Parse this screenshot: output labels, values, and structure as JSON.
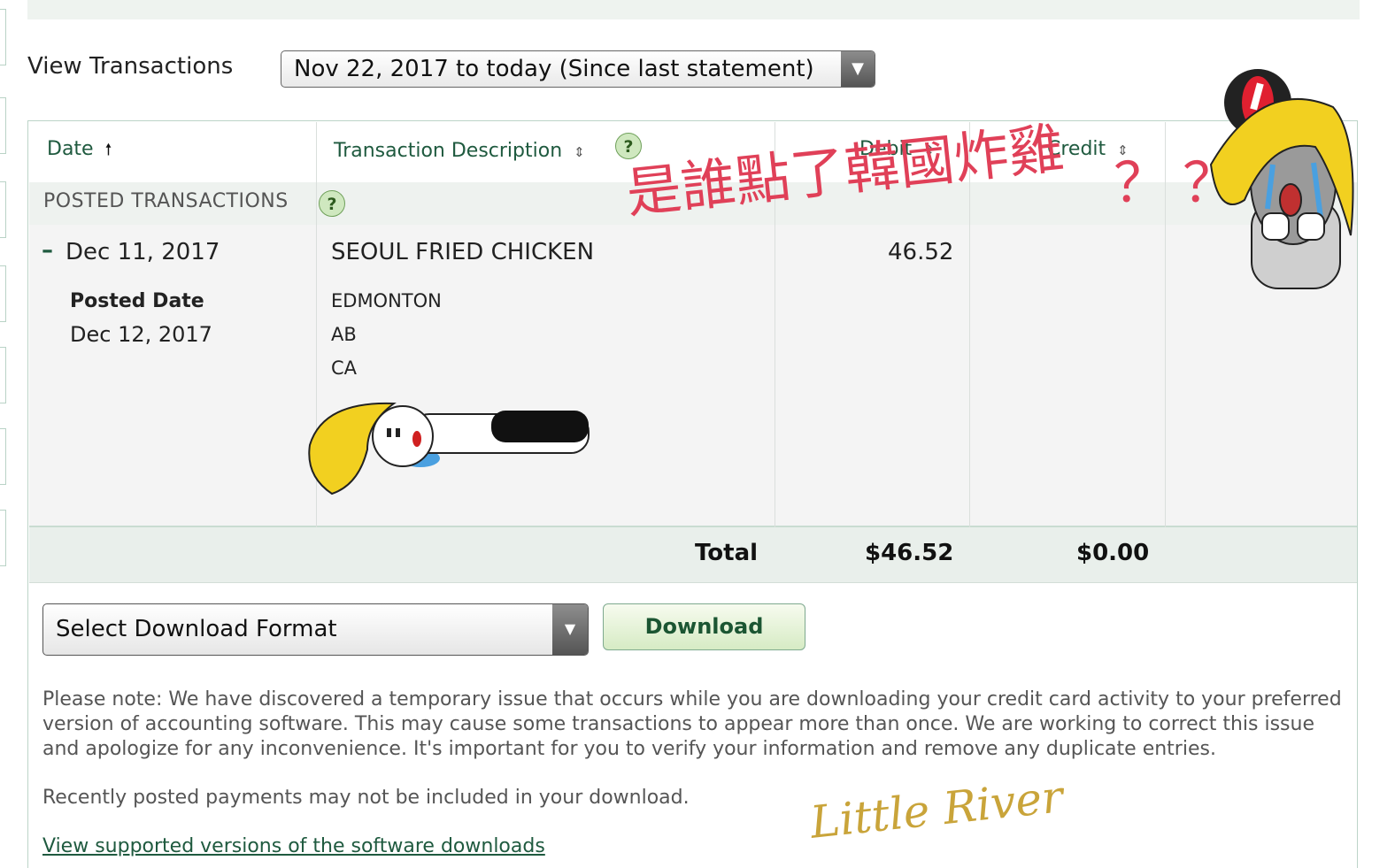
{
  "filter": {
    "label": "View Transactions",
    "selected": "Nov 22, 2017 to today (Since last statement)"
  },
  "table": {
    "headers": {
      "date": "Date",
      "description": "Transaction Description",
      "debit": "Debit",
      "credit": "Credit"
    },
    "section_title": "POSTED TRANSACTIONS",
    "help_glyph": "?",
    "transaction": {
      "toggle": "–",
      "date": "Dec 11, 2017",
      "posted_label": "Posted Date",
      "posted_date": "Dec 12, 2017",
      "merchant": "SEOUL FRIED CHICKEN",
      "city": "EDMONTON",
      "province": "AB",
      "country": "CA",
      "debit": "46.52"
    },
    "totals": {
      "label": "Total",
      "debit": "$46.52",
      "credit": "$0.00"
    }
  },
  "download": {
    "format_placeholder": "Select Download Format",
    "button": "Download"
  },
  "notes": {
    "issue": "Please note: We have discovered a temporary issue that occurs while you are downloading your credit card activity to your preferred version of accounting software. This may cause some transactions to appear more than once. We are working to correct this issue and apologize for any inconvenience. It's important for you to verify your information and remove any duplicate entries.",
    "payments": "Recently posted payments may not be included in your download.",
    "link": "View supported versions of the software downloads"
  },
  "overlay": {
    "chinese_caption": "是誰點了韓國炸雞",
    "question_marks": "？？",
    "watermark": "Little River"
  },
  "colors": {
    "accent_green": "#1f5a3f",
    "overlay_red": "#e04058",
    "watermark_gold": "#c9a43a"
  }
}
